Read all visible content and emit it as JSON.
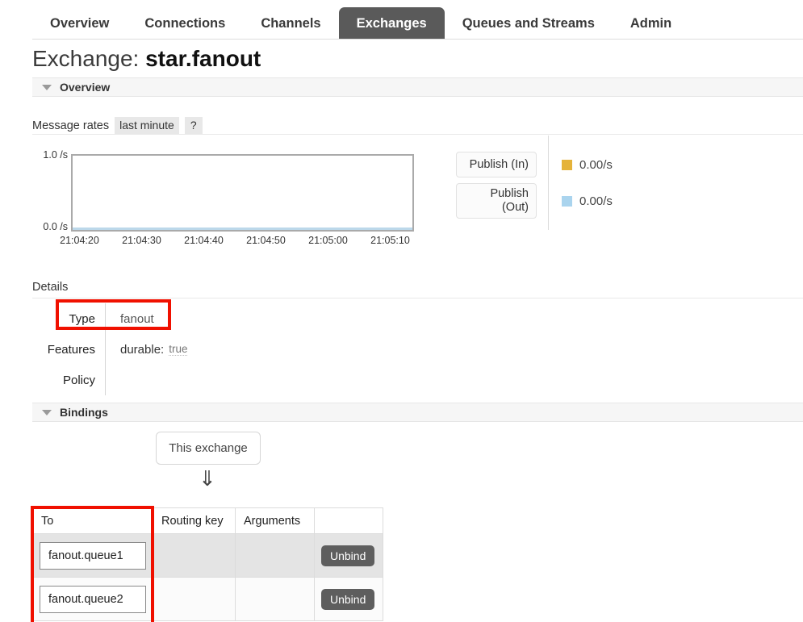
{
  "nav": {
    "items": [
      {
        "label": "Overview",
        "active": false
      },
      {
        "label": "Connections",
        "active": false
      },
      {
        "label": "Channels",
        "active": false
      },
      {
        "label": "Exchanges",
        "active": true
      },
      {
        "label": "Queues and Streams",
        "active": false
      },
      {
        "label": "Admin",
        "active": false
      }
    ]
  },
  "page": {
    "title_prefix": "Exchange:",
    "title_name": "star.fanout"
  },
  "overview_section": {
    "label": "Overview"
  },
  "message_rates": {
    "label": "Message rates",
    "period": "last minute",
    "help": "?"
  },
  "chart_data": {
    "type": "line",
    "title": "Message rates",
    "xlabel": "",
    "ylabel": "",
    "ylim": [
      0.0,
      1.0
    ],
    "y_ticks": [
      "0.0 /s",
      "1.0 /s"
    ],
    "x_ticks": [
      "21:04:20",
      "21:04:30",
      "21:04:40",
      "21:04:50",
      "21:05:00",
      "21:05:10"
    ],
    "grid": false,
    "legend_position": "right",
    "series": [
      {
        "name": "Publish (In)",
        "color": "#e5b33a",
        "rate": "0.00/s",
        "values": [
          0,
          0,
          0,
          0,
          0,
          0
        ]
      },
      {
        "name": "Publish (Out)",
        "color": "#aad4ee",
        "rate": "0.00/s",
        "values": [
          0,
          0,
          0,
          0,
          0,
          0
        ]
      }
    ]
  },
  "legend": {
    "rows": [
      {
        "button": "Publish (In)",
        "rate": "0.00/s",
        "color": "#e5b33a"
      },
      {
        "button": "Publish\n(Out)",
        "rate": "0.00/s",
        "color": "#aad4ee"
      }
    ]
  },
  "details": {
    "label": "Details",
    "rows": [
      {
        "key": "Type",
        "value": "fanout"
      },
      {
        "key": "Features",
        "value": ""
      },
      {
        "key": "Policy",
        "value": ""
      }
    ],
    "features": {
      "key": "durable:",
      "value": "true"
    }
  },
  "bindings_section": {
    "label": "Bindings"
  },
  "bindings": {
    "source_button": "This exchange",
    "arrow": "⇓",
    "columns": [
      "To",
      "Routing key",
      "Arguments",
      ""
    ],
    "rows": [
      {
        "to": "fanout.queue1",
        "routing_key": "",
        "arguments": "",
        "action": "Unbind"
      },
      {
        "to": "fanout.queue2",
        "routing_key": "",
        "arguments": "",
        "action": "Unbind"
      }
    ]
  },
  "annotations": {
    "accent_color": "#f01000",
    "highlighted": [
      "Type row",
      "To column"
    ]
  }
}
